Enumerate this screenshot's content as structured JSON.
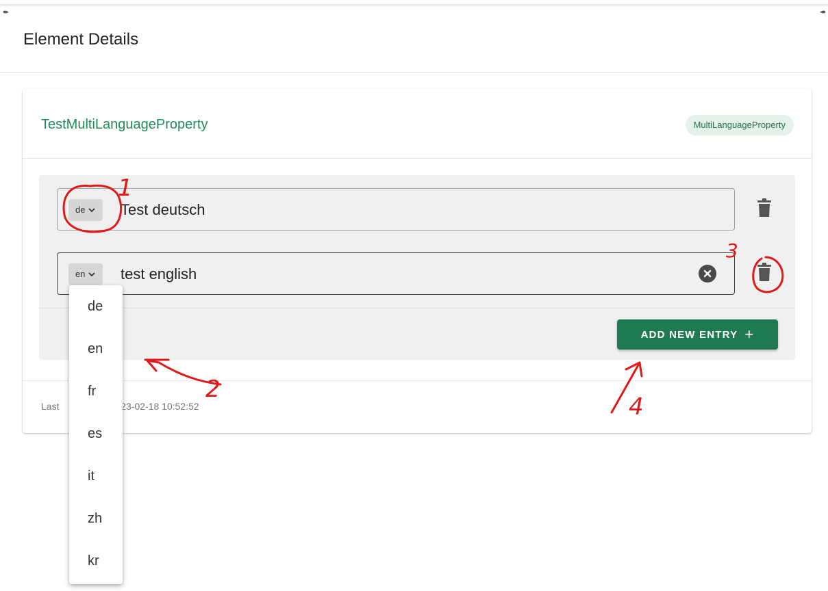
{
  "header": {
    "title": "Element Details"
  },
  "element": {
    "name": "TestMultiLanguageProperty",
    "type_chip": "MultiLanguageProperty"
  },
  "entries": [
    {
      "language": "de",
      "text": "Test deutsch"
    },
    {
      "language": "en",
      "text": "test english"
    }
  ],
  "add_button": {
    "label": "ADD NEW ENTRY",
    "plus": "+"
  },
  "footer": {
    "last_updated_prefix": "Last",
    "last_updated_suffix": "23-02-18 10:52:52"
  },
  "dropdown": {
    "options": [
      "de",
      "en",
      "fr",
      "es",
      "it",
      "zh",
      "kr"
    ]
  },
  "annotations": {
    "n1": "1",
    "n2": "2",
    "n3": "3",
    "n4": "4"
  },
  "colors": {
    "accent": "#1f7a52",
    "title": "#1e8a5a",
    "annotation": "#e01818"
  },
  "icons": {
    "delete": "trash-icon",
    "clear": "close-circle-icon",
    "lang_toggle": "chevron-down-icon",
    "add": "plus-icon"
  }
}
